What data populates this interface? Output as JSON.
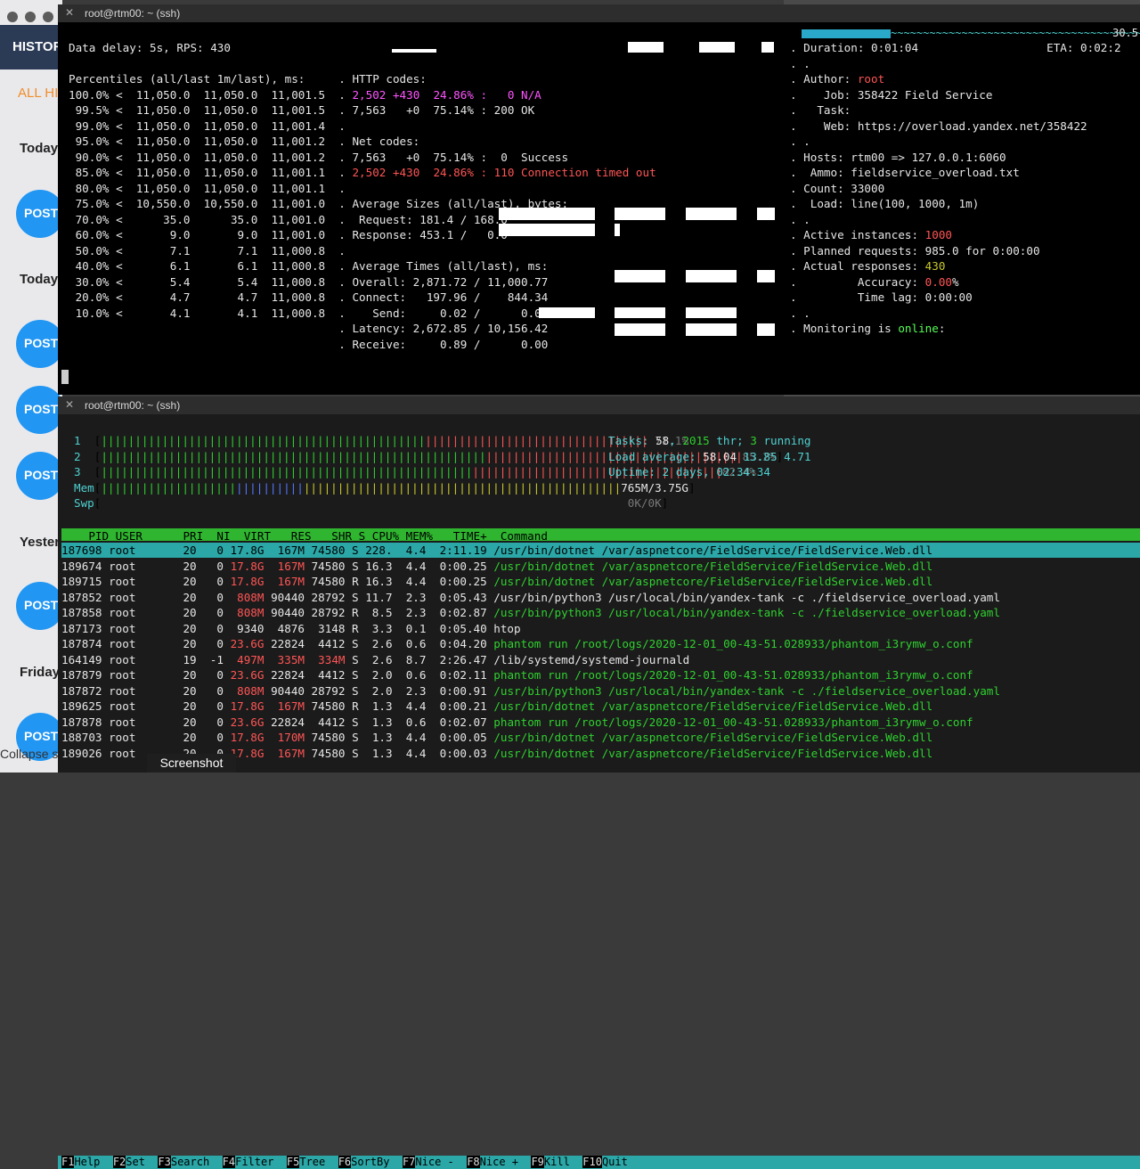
{
  "left_app": {
    "header": "HISTOF",
    "all": "ALL HI",
    "sections": [
      "Today",
      "Today",
      "Yester",
      "Friday"
    ],
    "post": "POST",
    "collapse": "Collapse s"
  },
  "term1": {
    "title": "root@rtm00: ~ (ssh)",
    "eta_right": "30.5",
    "lines": [
      "Data delay: 5s, RPS: 430",
      "",
      "Percentiles (all/last 1m/last), ms:     . HTTP codes:",
      "100.0% <  11,050.0  11,050.0  11,001.5  . 2,502 +430  24.86% :   0 N/A",
      " 99.5% <  11,050.0  11,050.0  11,001.5  . 7,563   +0  75.14% : 200 OK",
      " 99.0% <  11,050.0  11,050.0  11,001.4  .",
      " 95.0% <  11,050.0  11,050.0  11,001.2  . Net codes:",
      " 90.0% <  11,050.0  11,050.0  11,001.2  . 7,563   +0  75.14% :  0  Success",
      " 85.0% <  11,050.0  11,050.0  11,001.1  . 2,502 +430  24.86% : 110 Connection timed out",
      " 80.0% <  11,050.0  11,050.0  11,001.1  .",
      " 75.0% <  10,550.0  10,550.0  11,001.0  . Average Sizes (all/last), bytes:",
      " 70.0% <      35.0      35.0  11,001.0  .  Request: 181.4 / 168.0",
      " 60.0% <       9.0       9.0  11,001.0  . Response: 453.1 /   0.0",
      " 50.0% <       7.1       7.1  11,000.8  .",
      " 40.0% <       6.1       6.1  11,000.8  . Average Times (all/last), ms:",
      " 30.0% <       5.4       5.4  11,000.8  . Overall: 2,871.72 / 11,000.77",
      " 20.0% <       4.7       4.7  11,000.8  . Connect:   197.96 /    844.34",
      " 10.0% <       4.1       4.1  11,000.8  .    Send:     0.02 /      0.02",
      "                                        . Latency: 2,672.85 / 10,156.42",
      "                                        . Receive:     0.89 /      0.00"
    ],
    "right": [
      "Duration: 0:01:04                   ETA: 0:02:2",
      ".",
      "Author: root",
      "   Job: 358422 Field Service",
      "  Task:",
      "   Web: https://overload.yandex.net/358422",
      ".",
      "Hosts: rtm00 => 127.0.0.1:6060",
      " Ammo: fieldservice_overload.txt",
      "Count: 33000",
      " Load: line(100, 1000, 1m)",
      ".",
      "Active instances: 1000",
      "Planned requests: 985.0 for 0:00:00",
      "Actual responses: 430",
      "        Accuracy: 0.00%",
      "        Time lag: 0:00:00",
      ".",
      "Monitoring is online:"
    ]
  },
  "term2": {
    "title": "root@rtm00: ~ (ssh)",
    "cpu": [
      {
        "label": "1",
        "pct": "71.1%"
      },
      {
        "label": "2",
        "pct": "85.2%"
      },
      {
        "label": "3",
        "pct": "82.4%"
      }
    ],
    "mem": "765M/3.75G",
    "swp": "0K/0K",
    "tasks": "58",
    "thr": "2015",
    "running": "3",
    "load": [
      "58.04",
      "13.85",
      "4.71"
    ],
    "uptime": "2 days, 02:34:34",
    "header": "    PID USER      PRI  NI  VIRT   RES   SHR S CPU% MEM%   TIME+  Command",
    "rows": [
      "187698 root       20   0 17.8G  167M 74580 S 228.  4.4  2:11.19 /usr/bin/dotnet /var/aspnetcore/FieldService/FieldService.Web.dll",
      "189674 root       20   0 17.8G  167M 74580 S 16.3  4.4  0:00.25 /usr/bin/dotnet /var/aspnetcore/FieldService/FieldService.Web.dll",
      "189715 root       20   0 17.8G  167M 74580 R 16.3  4.4  0:00.25 /usr/bin/dotnet /var/aspnetcore/FieldService/FieldService.Web.dll",
      "187852 root       20   0  808M 90440 28792 S 11.7  2.3  0:05.43 /usr/bin/python3 /usr/local/bin/yandex-tank -c ./fieldservice_overload.yaml",
      "187858 root       20   0  808M 90440 28792 R  8.5  2.3  0:02.87 /usr/bin/python3 /usr/local/bin/yandex-tank -c ./fieldservice_overload.yaml",
      "187173 root       20   0  9340  4876  3148 R  3.3  0.1  0:05.40 htop",
      "187874 root       20   0 23.6G 22824  4412 S  2.6  0.6  0:04.20 phantom run /root/logs/2020-12-01_00-43-51.028933/phantom_i3rymw_o.conf",
      "164149 root       19  -1  497M  335M  334M S  2.6  8.7  2:26.47 /lib/systemd/systemd-journald",
      "187879 root       20   0 23.6G 22824  4412 S  2.0  0.6  0:02.11 phantom run /root/logs/2020-12-01_00-43-51.028933/phantom_i3rymw_o.conf",
      "187872 root       20   0  808M 90440 28792 S  2.0  2.3  0:00.91 /usr/bin/python3 /usr/local/bin/yandex-tank -c ./fieldservice_overload.yaml",
      "189625 root       20   0 17.8G  167M 74580 R  1.3  4.4  0:00.21 /usr/bin/dotnet /var/aspnetcore/FieldService/FieldService.Web.dll",
      "187878 root       20   0 23.6G 22824  4412 S  1.3  0.6  0:02.07 phantom run /root/logs/2020-12-01_00-43-51.028933/phantom_i3rymw_o.conf",
      "188703 root       20   0 17.8G  170M 74580 S  1.3  4.4  0:00.05 /usr/bin/dotnet /var/aspnetcore/FieldService/FieldService.Web.dll",
      "189026 root       20   0 17.8G  167M 74580 S  1.3  4.4  0:00.03 /usr/bin/dotnet /var/aspnetcore/FieldService/FieldService.Web.dll"
    ],
    "fkeys": [
      [
        "F1",
        "Help"
      ],
      [
        "F2",
        "Set"
      ],
      [
        "F3",
        "Search"
      ],
      [
        "F4",
        "Filter"
      ],
      [
        "F5",
        "Tree"
      ],
      [
        "F6",
        "SortBy"
      ],
      [
        "F7",
        "Nice -"
      ],
      [
        "F8",
        "Nice +"
      ],
      [
        "F9",
        "Kill"
      ],
      [
        "F10",
        "Quit"
      ]
    ]
  },
  "screenshot_label": "Screenshot"
}
